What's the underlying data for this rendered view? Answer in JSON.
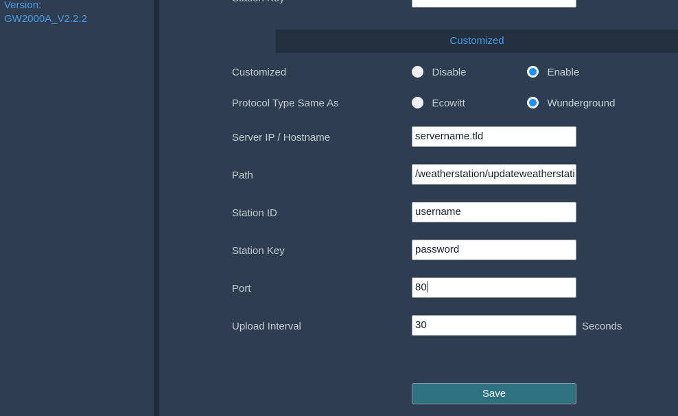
{
  "sidebar": {
    "version_label": "Version:",
    "version_value": "GW2000A_V2.2.2"
  },
  "clipped_top_row": {
    "label": "Station Key",
    "value": ""
  },
  "section": {
    "header": "Customized"
  },
  "form": {
    "customized": {
      "label": "Customized",
      "options": [
        {
          "label": "Disable",
          "selected": false
        },
        {
          "label": "Enable",
          "selected": true
        }
      ]
    },
    "protocol_type": {
      "label": "Protocol Type Same As",
      "options": [
        {
          "label": "Ecowitt",
          "selected": false
        },
        {
          "label": "Wunderground",
          "selected": true
        }
      ]
    },
    "fields": [
      {
        "label": "Server IP / Hostname",
        "value": "servername.tld",
        "suffix": "",
        "focused": false
      },
      {
        "label": "Path",
        "value": "/weatherstation/updateweatherstati",
        "suffix": "",
        "focused": false
      },
      {
        "label": "Station ID",
        "value": "username",
        "suffix": "",
        "focused": false
      },
      {
        "label": "Station Key",
        "value": "password",
        "suffix": "",
        "focused": false
      },
      {
        "label": "Port",
        "value": "80",
        "suffix": "",
        "focused": true
      },
      {
        "label": "Upload Interval",
        "value": "30",
        "suffix": "Seconds",
        "focused": false
      }
    ],
    "save_label": "Save"
  },
  "colors": {
    "background": "#2e3e50",
    "divider": "#1e2c3c",
    "section_header_bg": "#222f3e",
    "accent_blue": "#4a9ce8",
    "radio_selected": "#1e90ff",
    "save_button": "#2e7180",
    "label_text": "#c3cbd4"
  }
}
